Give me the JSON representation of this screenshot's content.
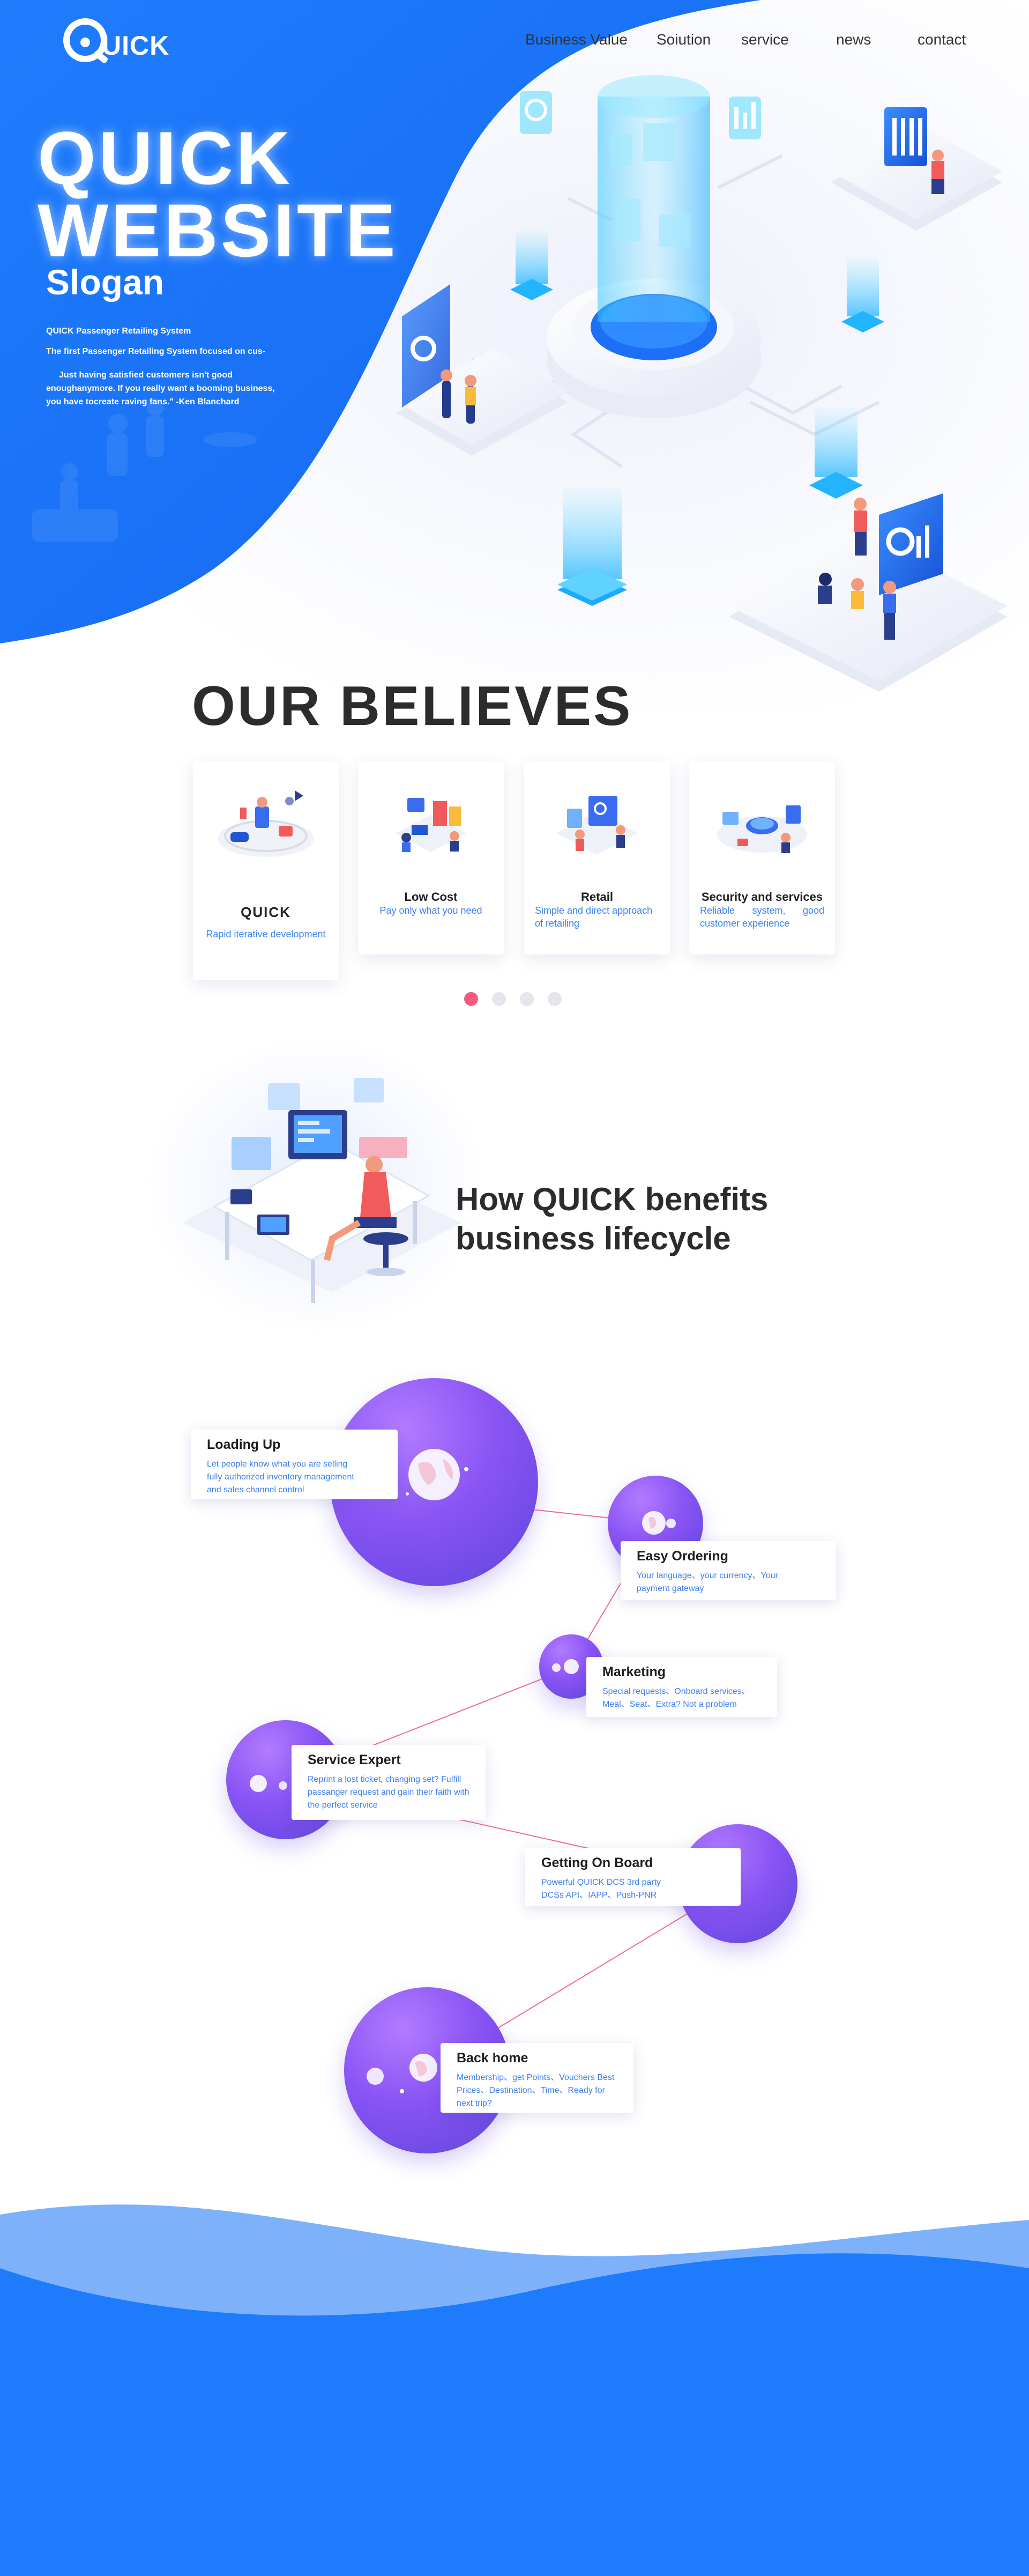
{
  "brand": {
    "logo_text": "UICK"
  },
  "nav": {
    "items": [
      "Business Value",
      "Soiution",
      "service",
      "news",
      "contact"
    ]
  },
  "hero": {
    "title_line1": "QUICK",
    "title_line2": "WEBSITE",
    "slogan": "Slogan",
    "p1": "QUICK Passenger Retailing System",
    "p2": "The first Passenger Retailing System focused on cus-",
    "p3": "Just having satisfied customers isn't good enoughanymore. If you really want a booming business, you have tocreate raving fans.\" -Ken Blanchard"
  },
  "believes": {
    "title": "OUR BELIEVES",
    "cards": [
      {
        "title": "QUICK",
        "desc": "Rapid iterative development"
      },
      {
        "title": "Low Cost",
        "desc": "Pay only what you need"
      },
      {
        "title": "Retail",
        "desc": "Simple and direct approach of retailing"
      },
      {
        "title": "Security and services",
        "desc": "Reliable system, good customer experience"
      }
    ],
    "active_dot": 0
  },
  "benefits": {
    "title_line1": "How QUICK benefits",
    "title_line2": "business lifecycle"
  },
  "lifecycle": {
    "steps": [
      {
        "title": "Loading Up",
        "desc": "Let people know what you are selling fully authorized inventory management and sales channel control"
      },
      {
        "title": "Easy Ordering",
        "desc": "Your language、your currency、Your payment gateway"
      },
      {
        "title": "Marketing",
        "desc": "Special requests、Onboard services、Meal、Seat、Extra? Not a problem"
      },
      {
        "title": "Service Expert",
        "desc": "Reprint a lost ticket, changing set? Fulfill passanger request and gain their faith with the perfect service"
      },
      {
        "title": "Getting On Board",
        "desc": "Powerful QUICK DCS 3rd party DCSs API、IAPP、Push-PNR"
      },
      {
        "title": "Back home",
        "desc": "Membership、get Points、Vouchers Best Prices、Destination、Time、Ready for next trip?"
      }
    ]
  },
  "colors": {
    "primary_blue": "#1e7bfb",
    "accent_pink": "#f75a7f",
    "planet_purple": "#8a54f5",
    "desc_blue": "#3b7ef0"
  }
}
